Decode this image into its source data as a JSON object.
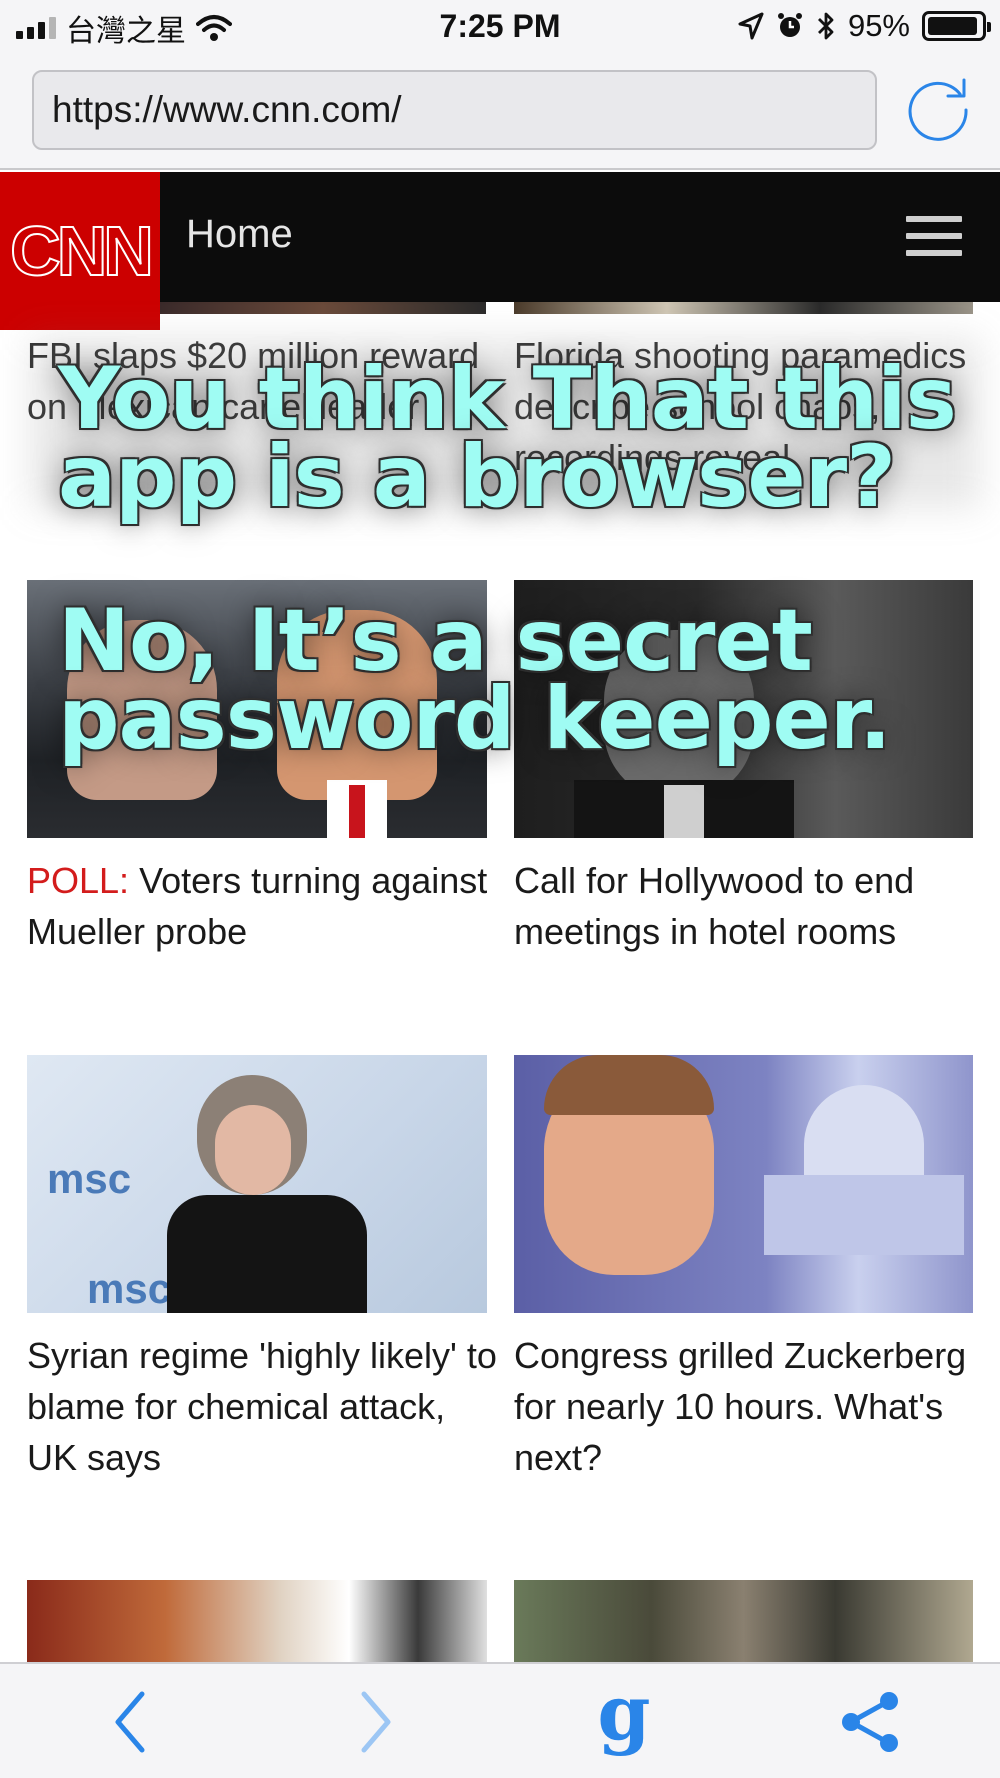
{
  "status_bar": {
    "carrier": "台灣之星",
    "time": "7:25 PM",
    "battery": "95%",
    "icons": [
      "signal-icon",
      "wifi-icon",
      "location-icon",
      "alarm-icon",
      "bluetooth-icon",
      "battery-icon"
    ]
  },
  "browser": {
    "url": "https://www.cnn.com/",
    "reload_icon": "reload-icon"
  },
  "cnn": {
    "logo": "CNN",
    "section": "Home",
    "menu_icon": "hamburger-menu-icon",
    "brand_color": "#cc0000"
  },
  "stories": [
    {
      "title": "FBI slaps $20 million reward on Mexican cartel leader"
    },
    {
      "title": "Florida shooting paramedics describe school chaos, recordings reveal"
    },
    {
      "tag": "POLL:",
      "title": " Voters turning against Mueller probe"
    },
    {
      "title": "Call for Hollywood to end meetings in hotel rooms"
    },
    {
      "title": "Syrian regime 'highly likely' to blame for chemical attack, UK says"
    },
    {
      "title": "Congress grilled Zuckerberg for nearly 10 hours. What's next?"
    }
  ],
  "overlay": {
    "line1": "You think That this",
    "line2": "app is a browser?",
    "line3": "No, It’s a secret",
    "line4": "password keeper."
  },
  "toolbar": {
    "back_icon": "chevron-left-icon",
    "forward_icon": "chevron-right-icon",
    "google_glyph": "g",
    "share_icon": "share-icon",
    "accent_color": "#2a85e8"
  }
}
